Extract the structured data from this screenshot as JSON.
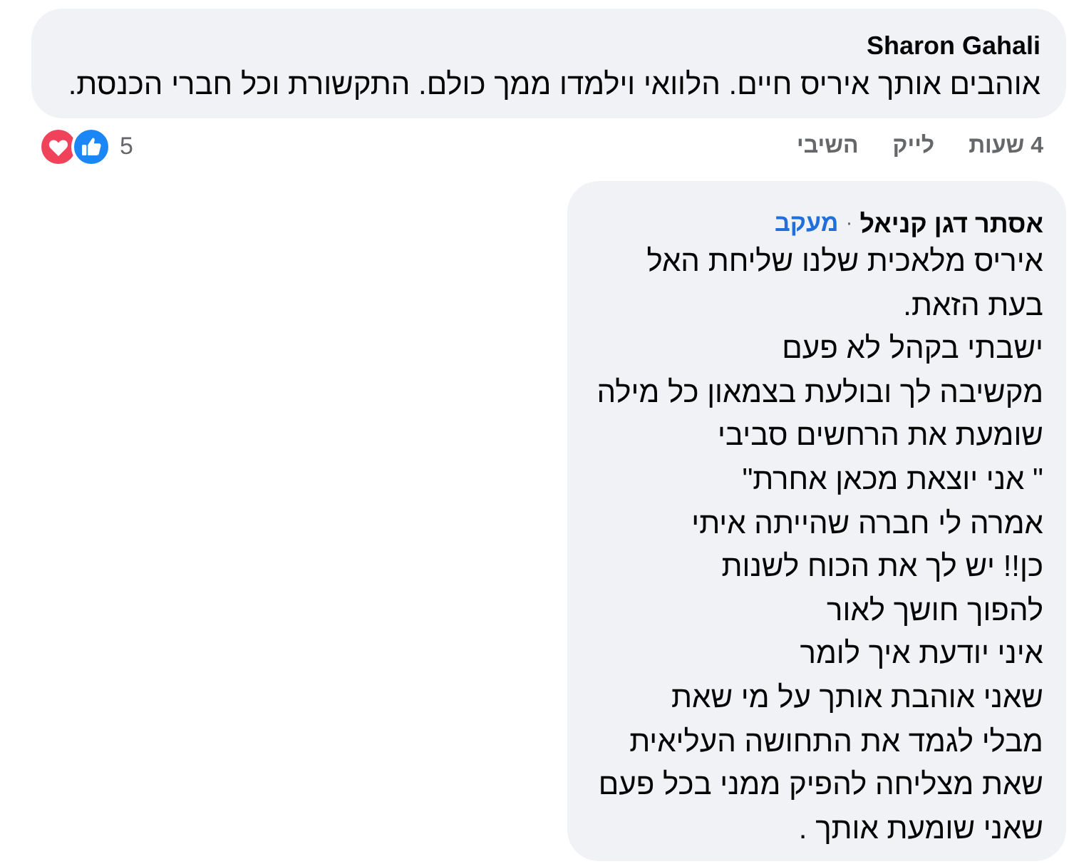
{
  "comments": [
    {
      "author": "Sharon Gahali",
      "text": "אוהבים אותך איריס חיים. הלוואי וילמדו ממך כולם. התקשורת וכל חברי הכנסת.",
      "actions": [
        "4 שעות",
        "לייק",
        "השיבי"
      ],
      "reaction_count": "5"
    },
    {
      "author": "אסתר דגן קניאל",
      "separator": "·",
      "follow": "מעקב",
      "lines": [
        "איריס מלאכית שלנו שליחת האל",
        "בעת הזאת.",
        "ישבתי בקהל לא פעם",
        "מקשיבה לך ובולעת בצמאון כל מילה",
        "שומעת את הרחשים סביבי",
        "\" אני יוצאת מכאן אחרת\"",
        "אמרה לי חברה שהייתה איתי",
        "כן!! יש לך את הכוח לשנות",
        "להפוך חושך לאור",
        "איני יודעת איך לומר",
        "שאני אוהבת אותך על מי שאת",
        "מבלי לגמד את התחושה העליאית",
        "שאת מצליחה להפיק ממני בכל פעם",
        "שאני שומעת אותך ."
      ]
    }
  ]
}
